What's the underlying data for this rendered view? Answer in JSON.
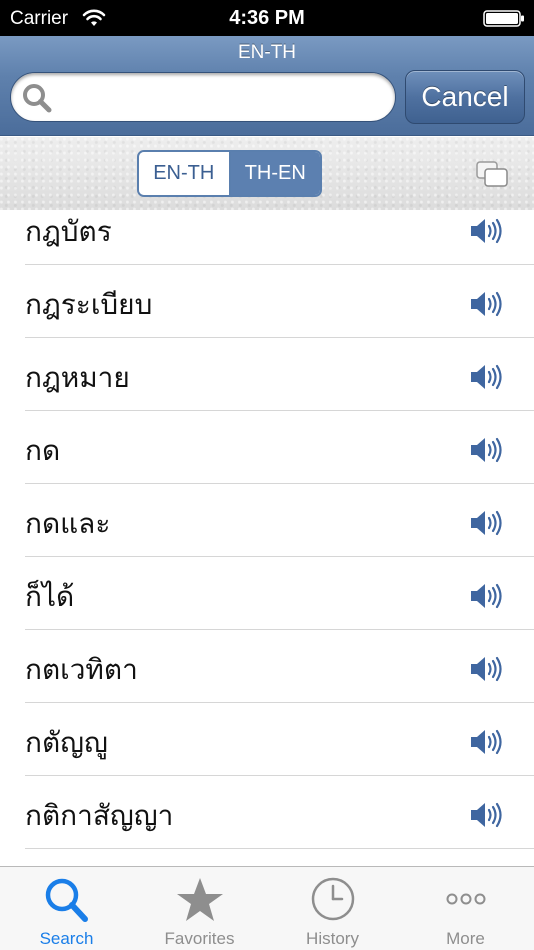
{
  "status_bar": {
    "carrier": "Carrier",
    "time": "4:36 PM"
  },
  "header": {
    "title": "EN-TH",
    "search": {
      "value": "",
      "placeholder": ""
    },
    "cancel_label": "Cancel"
  },
  "toolbar": {
    "segments": [
      {
        "label": "EN-TH",
        "selected": false
      },
      {
        "label": "TH-EN",
        "selected": true
      }
    ]
  },
  "words": [
    {
      "text": "กฎบัตร"
    },
    {
      "text": "กฎระเบียบ"
    },
    {
      "text": "กฎหมาย"
    },
    {
      "text": "กด"
    },
    {
      "text": "กดและ"
    },
    {
      "text": "ก็ได้"
    },
    {
      "text": "กตเวทิตา"
    },
    {
      "text": "กตัญญู"
    },
    {
      "text": "กติกาสัญญา"
    }
  ],
  "tabs": [
    {
      "label": "Search",
      "icon": "search-icon",
      "active": true
    },
    {
      "label": "Favorites",
      "icon": "star-icon",
      "active": false
    },
    {
      "label": "History",
      "icon": "clock-icon",
      "active": false
    },
    {
      "label": "More",
      "icon": "more-dots-icon",
      "active": false
    }
  ],
  "colors": {
    "nav_blue": "#5f81ad",
    "segment_selected": "#5c80b0",
    "tab_active": "#1a7ee8",
    "tab_inactive": "#8e8e8e",
    "speaker_blue": "#3f66a0"
  }
}
